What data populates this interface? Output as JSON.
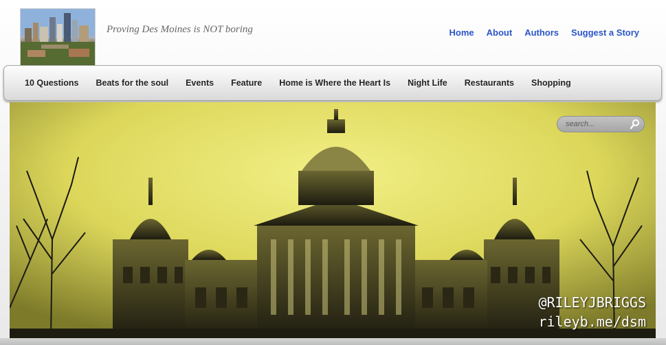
{
  "header": {
    "logo_icon": "des-moines-skyline-photo",
    "tagline": "Proving Des Moines is NOT boring",
    "nav": [
      {
        "label": "Home"
      },
      {
        "label": "About"
      },
      {
        "label": "Authors"
      },
      {
        "label": "Suggest a Story"
      }
    ]
  },
  "categories": [
    {
      "label": "10 Questions"
    },
    {
      "label": "Beats for the soul"
    },
    {
      "label": "Events"
    },
    {
      "label": "Feature"
    },
    {
      "label": "Home is Where the Heart Is"
    },
    {
      "label": "Night Life"
    },
    {
      "label": "Restaurants"
    },
    {
      "label": "Shopping"
    }
  ],
  "hero": {
    "image_icon": "iowa-state-capitol-photo",
    "search_placeholder": "search...",
    "search_icon": "magnifier-icon",
    "watermark_line1": "@RILEYJBRIGGS",
    "watermark_line2": "rileyb.me/dsm"
  },
  "colors": {
    "link_blue": "#2a55c8",
    "sky_yellow": "#e8e66a",
    "silhouette": "#1e1c10"
  }
}
